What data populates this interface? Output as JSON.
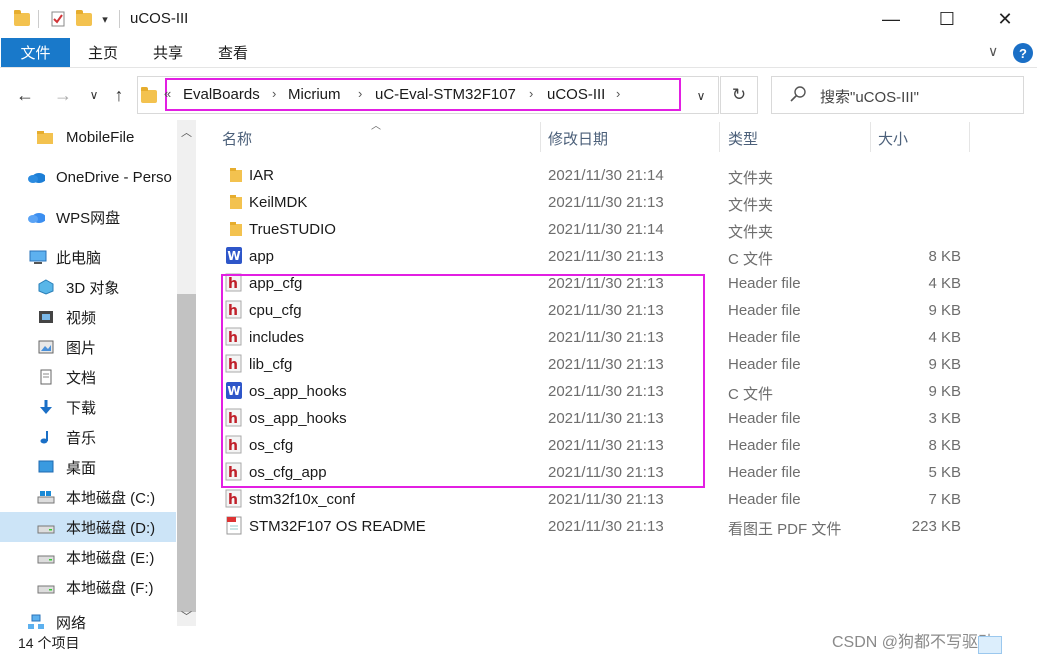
{
  "window": {
    "title": "uCOS-III",
    "qat_dropdown": "▾",
    "minimize": "—",
    "maximize": "☐",
    "close": "✕"
  },
  "ribbon": {
    "tabs": [
      "文件",
      "主页",
      "共享",
      "查看"
    ],
    "help": "?",
    "collapse": "∨"
  },
  "address": {
    "overflow": "«",
    "crumbs": [
      "EvalBoards",
      "Micrium",
      "uC-Eval-STM32F107",
      "uCOS-III"
    ],
    "refresh": "↻",
    "search_placeholder": "搜索\"uCOS-III\""
  },
  "nav": {
    "back": "←",
    "forward": "→",
    "recent": "∨",
    "up": "↑"
  },
  "sidebar": {
    "items": [
      {
        "label": "MobileFile",
        "icon": "folder-icon"
      },
      {
        "label": "OneDrive - Perso",
        "icon": "onedrive-icon"
      },
      {
        "label": "WPS网盘",
        "icon": "wps-cloud-icon"
      },
      {
        "label": "此电脑",
        "icon": "this-pc-icon"
      },
      {
        "label": "3D 对象",
        "icon": "3d-objects-icon"
      },
      {
        "label": "视频",
        "icon": "video-icon"
      },
      {
        "label": "图片",
        "icon": "pictures-icon"
      },
      {
        "label": "文档",
        "icon": "documents-icon"
      },
      {
        "label": "下载",
        "icon": "download-icon"
      },
      {
        "label": "音乐",
        "icon": "music-icon"
      },
      {
        "label": "桌面",
        "icon": "desktop-icon"
      },
      {
        "label": "本地磁盘 (C:)",
        "icon": "drive-c-icon"
      },
      {
        "label": "本地磁盘 (D:)",
        "icon": "drive-icon"
      },
      {
        "label": "本地磁盘 (E:)",
        "icon": "drive-icon"
      },
      {
        "label": "本地磁盘 (F:)",
        "icon": "drive-icon"
      },
      {
        "label": "网络",
        "icon": "network-icon"
      }
    ],
    "selected_index": 12
  },
  "columns": {
    "name": "名称",
    "date": "修改日期",
    "type": "类型",
    "size": "大小"
  },
  "files": [
    {
      "name": "IAR",
      "date": "2021/11/30 21:14",
      "type": "文件夹",
      "size": "",
      "icon": "folder"
    },
    {
      "name": "KeilMDK",
      "date": "2021/11/30 21:13",
      "type": "文件夹",
      "size": "",
      "icon": "folder"
    },
    {
      "name": "TrueSTUDIO",
      "date": "2021/11/30 21:14",
      "type": "文件夹",
      "size": "",
      "icon": "folder"
    },
    {
      "name": "app",
      "date": "2021/11/30 21:13",
      "type": "C 文件",
      "size": "8 KB",
      "icon": "c"
    },
    {
      "name": "app_cfg",
      "date": "2021/11/30 21:13",
      "type": "Header file",
      "size": "4 KB",
      "icon": "h"
    },
    {
      "name": "cpu_cfg",
      "date": "2021/11/30 21:13",
      "type": "Header file",
      "size": "9 KB",
      "icon": "h"
    },
    {
      "name": "includes",
      "date": "2021/11/30 21:13",
      "type": "Header file",
      "size": "4 KB",
      "icon": "h"
    },
    {
      "name": "lib_cfg",
      "date": "2021/11/30 21:13",
      "type": "Header file",
      "size": "9 KB",
      "icon": "h"
    },
    {
      "name": "os_app_hooks",
      "date": "2021/11/30 21:13",
      "type": "C 文件",
      "size": "9 KB",
      "icon": "c"
    },
    {
      "name": "os_app_hooks",
      "date": "2021/11/30 21:13",
      "type": "Header file",
      "size": "3 KB",
      "icon": "h"
    },
    {
      "name": "os_cfg",
      "date": "2021/11/30 21:13",
      "type": "Header file",
      "size": "8 KB",
      "icon": "h"
    },
    {
      "name": "os_cfg_app",
      "date": "2021/11/30 21:13",
      "type": "Header file",
      "size": "5 KB",
      "icon": "h"
    },
    {
      "name": "stm32f10x_conf",
      "date": "2021/11/30 21:13",
      "type": "Header file",
      "size": "7 KB",
      "icon": "h"
    },
    {
      "name": "STM32F107 OS README",
      "date": "2021/11/30 21:13",
      "type": "看图王 PDF 文件",
      "size": "223 KB",
      "icon": "pdf"
    }
  ],
  "status": {
    "item_count": "14 个项目"
  },
  "watermark": "CSDN @狗都不写驱动",
  "colors": {
    "accent": "#1979ca",
    "highlight": "#e21fe2",
    "selected": "#cce4f7"
  }
}
